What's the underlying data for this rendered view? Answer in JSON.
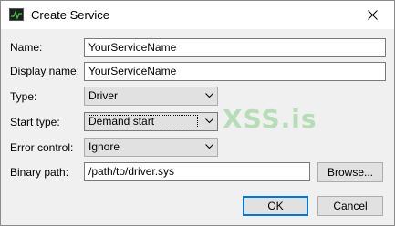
{
  "window": {
    "title": "Create Service",
    "icon": "activity-monitor-icon",
    "close_icon": "close-icon"
  },
  "form": {
    "name": {
      "label": "Name:",
      "value": "YourServiceName"
    },
    "display_name": {
      "label": "Display name:",
      "value": "YourServiceName"
    },
    "type": {
      "label": "Type:",
      "value": "Driver"
    },
    "start_type": {
      "label": "Start type:",
      "value": "Demand start"
    },
    "error_control": {
      "label": "Error control:",
      "value": "Ignore"
    },
    "binary_path": {
      "label": "Binary path:",
      "value": "/path/to/driver.sys",
      "browse_label": "Browse..."
    }
  },
  "buttons": {
    "ok": "OK",
    "cancel": "Cancel"
  },
  "watermark": {
    "text": "XSS.is"
  },
  "colors": {
    "default_button_border": "#0078d7",
    "dialog_bg": "#f0f0f0",
    "watermark": "#6ec86e"
  }
}
